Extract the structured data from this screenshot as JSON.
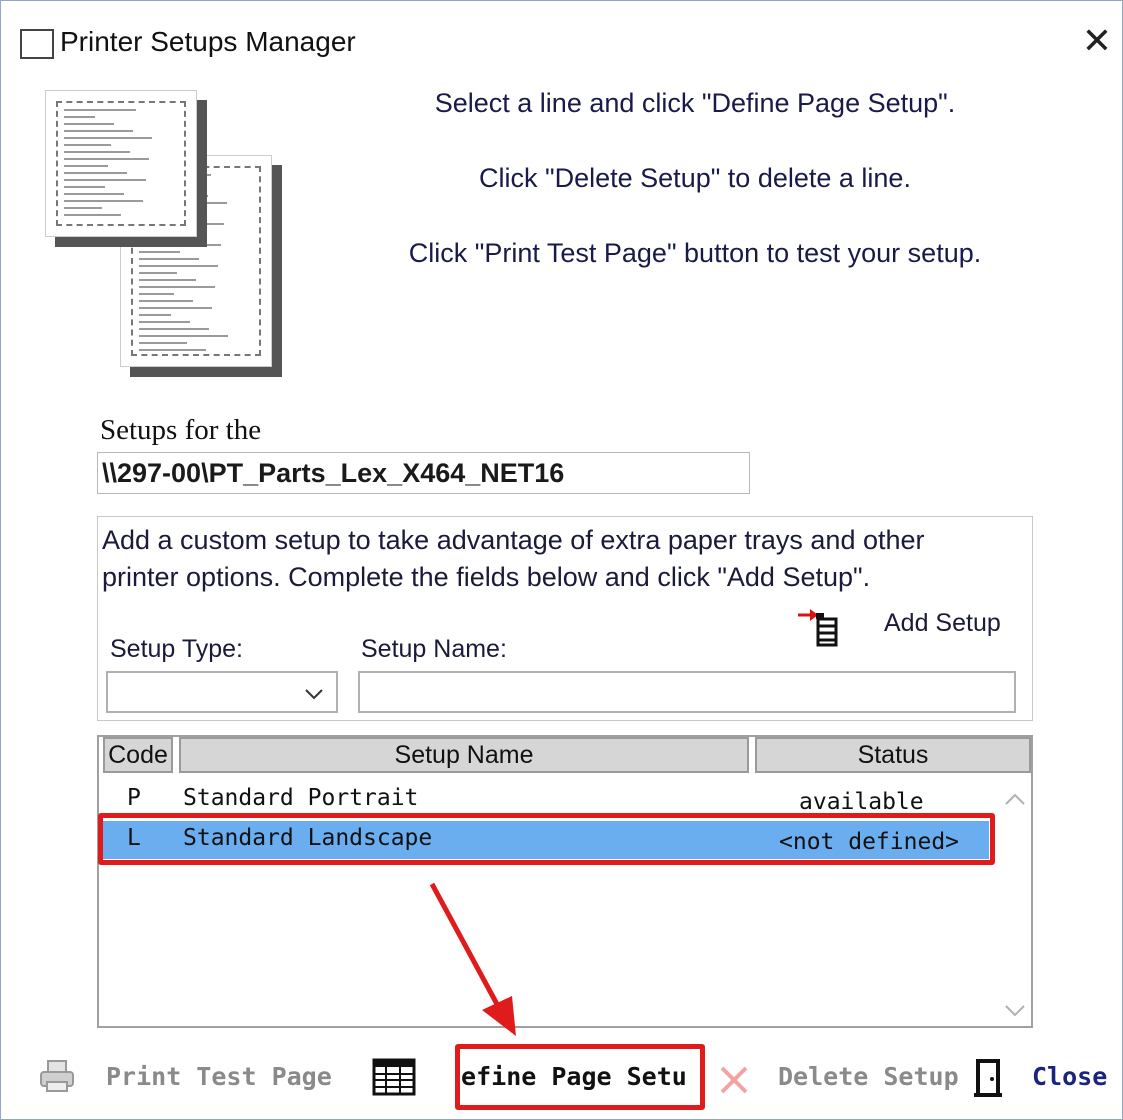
{
  "window": {
    "title": "Printer Setups Manager"
  },
  "instructions": [
    "Select a line and click \"Define Page Setup\".",
    "Click \"Delete Setup\" to delete a line.",
    "Click  \"Print Test Page\" button to test your setup."
  ],
  "printer": {
    "label": "Setups for the",
    "name": "\\\\297-00\\PT_Parts_Lex_X464_NET16"
  },
  "add_group": {
    "description_line1": "Add a custom setup to take advantage of extra paper trays and other",
    "description_line2": "printer options. Complete the fields below and click \"Add Setup\".",
    "add_button": "Add Setup",
    "setup_type_label": "Setup Type:",
    "setup_name_label": "Setup Name:",
    "setup_type_value": "",
    "setup_name_value": ""
  },
  "grid": {
    "columns": [
      "Code",
      "Setup Name",
      "Status"
    ],
    "rows": [
      {
        "code": "P",
        "name": "Standard Portrait",
        "status": "available",
        "selected": false
      },
      {
        "code": "L",
        "name": "Standard Landscape",
        "status": "<not defined>",
        "selected": true
      }
    ]
  },
  "toolbar": {
    "print_test": "Print Test Page",
    "define": "Define Page Setu",
    "delete": "Delete Setup",
    "close": "Close"
  },
  "colors": {
    "selection": "#6aaef0",
    "highlight": "#e01b1b",
    "close_text": "#1a237e",
    "disabled_text": "#8a8a8a"
  },
  "icons": [
    "window-icon",
    "close-icon",
    "pages-illustration",
    "add-setup-icon",
    "dropdown-chevron-icon",
    "scroll-up-icon",
    "scroll-down-icon",
    "arrow-annotation",
    "printer-icon",
    "grid-icon",
    "delete-x-icon",
    "door-icon"
  ]
}
